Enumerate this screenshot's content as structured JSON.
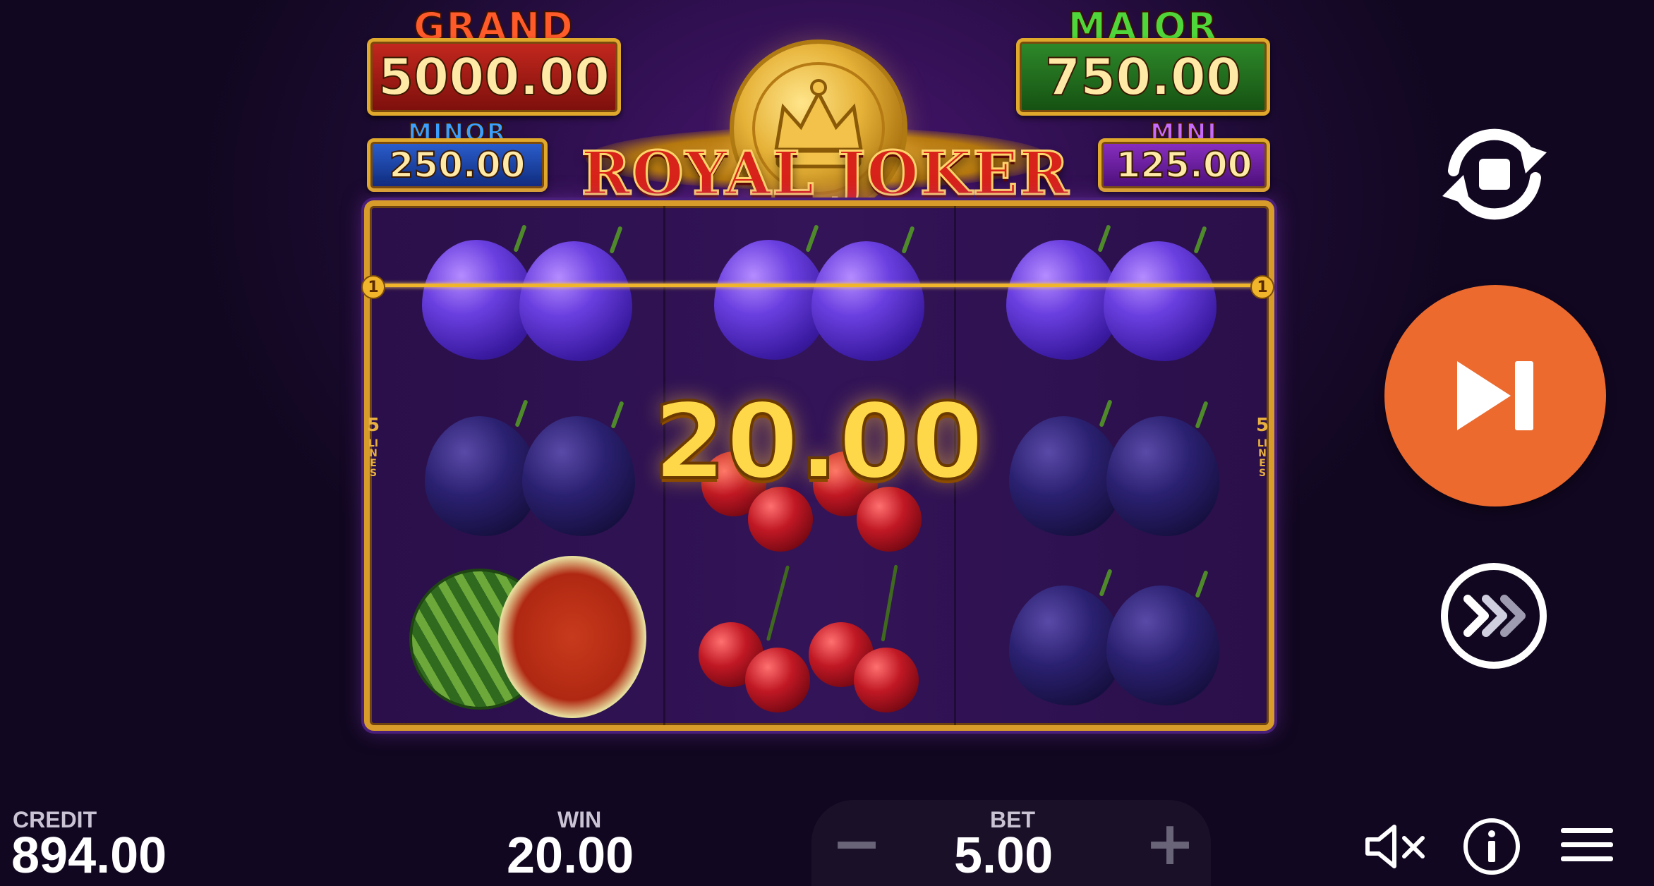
{
  "jackpots": {
    "grand": {
      "title": "GRAND",
      "value": "5000.00"
    },
    "major": {
      "title": "MAJOR",
      "value": "750.00"
    },
    "minor": {
      "title": "MINOR",
      "value": "250.00"
    },
    "mini": {
      "title": "MINI",
      "value": "125.00"
    }
  },
  "logo": {
    "text": "ROYAL JOKER"
  },
  "reels": {
    "payline_number": "1",
    "lines_count": "5",
    "lines_label": "LINES",
    "columns": [
      [
        "plum",
        "dark-plum",
        "watermelon"
      ],
      [
        "plum",
        "cherry",
        "cherry"
      ],
      [
        "plum",
        "dark-plum",
        "dark-plum"
      ]
    ]
  },
  "win_popup": "20.00",
  "footer": {
    "credit_label": "CREDIT",
    "credit_value": "894.00",
    "win_label": "WIN",
    "win_value": "20.00",
    "bet_label": "BET",
    "bet_value": "5.00",
    "bet_decrease": "−",
    "bet_increase": "+"
  },
  "icons": {
    "autoplay": "autoplay-icon",
    "spin": "skip-icon",
    "turbo": "turbo-icon",
    "sound": "sound-muted-icon",
    "info": "info-icon",
    "menu": "menu-icon"
  },
  "colors": {
    "spin_button": "#ec6a2e",
    "frame_gold": "#d89c2a",
    "background": "#2e0f4e"
  }
}
